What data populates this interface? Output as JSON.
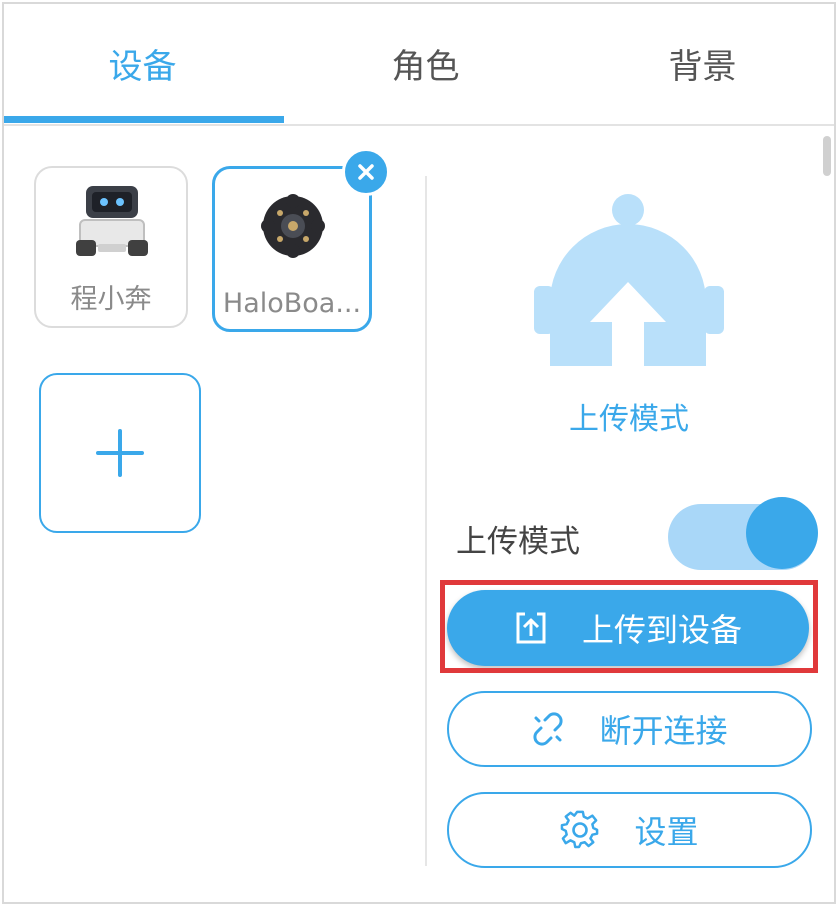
{
  "tabs": [
    {
      "label": "设备",
      "active": true
    },
    {
      "label": "角色",
      "active": false
    },
    {
      "label": "背景",
      "active": false
    }
  ],
  "devices": [
    {
      "name": "程小奔",
      "icon": "robot-car-icon",
      "selected": false
    },
    {
      "name": "HaloBoa...",
      "icon": "haloboard-icon",
      "selected": true
    }
  ],
  "add_device": {
    "icon": "plus-icon"
  },
  "panel": {
    "mode_caption": "上传模式",
    "toggle_label": "上传模式",
    "toggle_on": true,
    "upload_button": "上传到设备",
    "disconnect_button": "断开连接",
    "settings_button": "设置"
  },
  "colors": {
    "accent": "#3aa8ea",
    "accent_light": "#a9d7f8",
    "highlight": "#e0393b"
  }
}
